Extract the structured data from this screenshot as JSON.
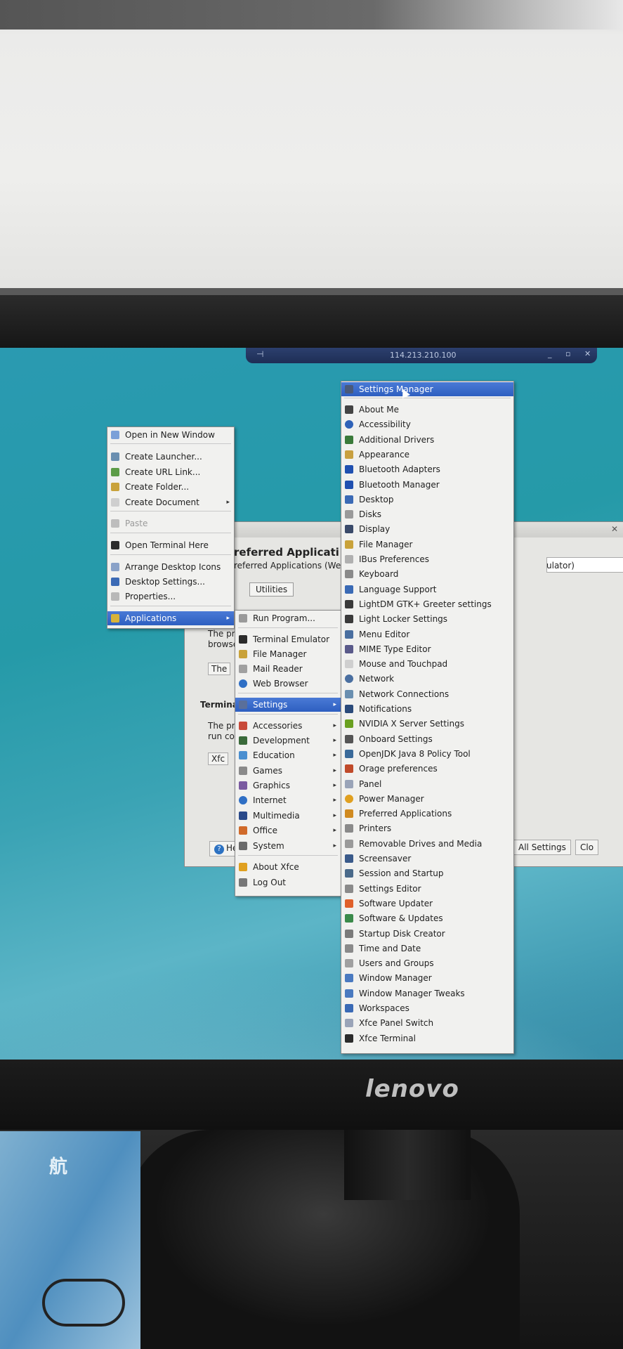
{
  "remote_bar": {
    "ip": "114.213.210.100",
    "pin_glyph": "⊣",
    "controls": "_ ▫ ✕"
  },
  "context_menu": {
    "items": [
      {
        "label": "Open in New Window",
        "highlighted": false,
        "disabled": false,
        "icon": "window-icon"
      },
      {
        "label": "Create Launcher...",
        "disabled": false,
        "icon": "launcher-icon"
      },
      {
        "label": "Create URL Link...",
        "disabled": false,
        "icon": "link-icon"
      },
      {
        "label": "Create Folder...",
        "disabled": false,
        "icon": "folder-icon"
      },
      {
        "label": "Create Document",
        "disabled": false,
        "submenu": true,
        "icon": "document-icon"
      },
      {
        "label": "Paste",
        "disabled": true,
        "icon": "paste-icon"
      },
      {
        "label": "Open Terminal Here",
        "disabled": false,
        "icon": "terminal-icon"
      },
      {
        "label": "Arrange Desktop Icons",
        "disabled": false,
        "icon": "arrange-icon"
      },
      {
        "label": "Desktop Settings...",
        "disabled": false,
        "icon": "desktop-icon"
      },
      {
        "label": "Properties...",
        "disabled": false,
        "icon": "properties-icon"
      },
      {
        "label": "Applications",
        "highlighted": true,
        "submenu": true,
        "icon": "applications-icon"
      }
    ]
  },
  "applications_menu": {
    "items": [
      {
        "label": "Run Program...",
        "icon": "run-icon"
      },
      {
        "label": "Terminal Emulator",
        "icon": "terminal-icon"
      },
      {
        "label": "File Manager",
        "icon": "file-manager-icon"
      },
      {
        "label": "Mail Reader",
        "icon": "mail-icon"
      },
      {
        "label": "Web Browser",
        "icon": "globe-icon"
      },
      {
        "label": "Settings",
        "highlighted": true,
        "submenu": true,
        "icon": "settings-icon"
      },
      {
        "label": "Accessories",
        "submenu": true,
        "icon": "accessories-icon"
      },
      {
        "label": "Development",
        "submenu": true,
        "icon": "development-icon"
      },
      {
        "label": "Education",
        "submenu": true,
        "icon": "education-icon"
      },
      {
        "label": "Games",
        "submenu": true,
        "icon": "games-icon"
      },
      {
        "label": "Graphics",
        "submenu": true,
        "icon": "graphics-icon"
      },
      {
        "label": "Internet",
        "submenu": true,
        "icon": "internet-icon"
      },
      {
        "label": "Multimedia",
        "submenu": true,
        "icon": "multimedia-icon"
      },
      {
        "label": "Office",
        "submenu": true,
        "icon": "office-icon"
      },
      {
        "label": "System",
        "submenu": true,
        "icon": "system-icon"
      },
      {
        "label": "About Xfce",
        "icon": "star-icon"
      },
      {
        "label": "Log Out",
        "icon": "logout-icon"
      }
    ]
  },
  "settings_menu": {
    "items": [
      {
        "label": "Settings Manager",
        "highlighted": true,
        "icon": "settings-manager-icon"
      },
      {
        "label": "About Me",
        "icon": "user-icon"
      },
      {
        "label": "Accessibility",
        "icon": "accessibility-icon"
      },
      {
        "label": "Additional Drivers",
        "icon": "chip-icon"
      },
      {
        "label": "Appearance",
        "icon": "appearance-icon"
      },
      {
        "label": "Bluetooth Adapters",
        "icon": "bluetooth-icon"
      },
      {
        "label": "Bluetooth Manager",
        "icon": "bluetooth-icon"
      },
      {
        "label": "Desktop",
        "icon": "desktop-icon"
      },
      {
        "label": "Disks",
        "icon": "disk-icon"
      },
      {
        "label": "Display",
        "icon": "display-icon"
      },
      {
        "label": "File Manager",
        "icon": "file-manager-icon"
      },
      {
        "label": "IBus Preferences",
        "icon": "ibus-icon"
      },
      {
        "label": "Keyboard",
        "icon": "keyboard-icon"
      },
      {
        "label": "Language Support",
        "icon": "language-icon"
      },
      {
        "label": "LightDM GTK+ Greeter settings",
        "icon": "lightdm-icon"
      },
      {
        "label": "Light Locker Settings",
        "icon": "lock-icon"
      },
      {
        "label": "Menu Editor",
        "icon": "menu-editor-icon"
      },
      {
        "label": "MIME Type Editor",
        "icon": "mime-icon"
      },
      {
        "label": "Mouse and Touchpad",
        "icon": "mouse-icon"
      },
      {
        "label": "Network",
        "icon": "network-icon"
      },
      {
        "label": "Network Connections",
        "icon": "network-connections-icon"
      },
      {
        "label": "Notifications",
        "icon": "notifications-icon"
      },
      {
        "label": "NVIDIA X Server Settings",
        "icon": "nvidia-icon"
      },
      {
        "label": "Onboard Settings",
        "icon": "onboard-icon"
      },
      {
        "label": "OpenJDK Java 8 Policy Tool",
        "icon": "java-icon"
      },
      {
        "label": "Orage preferences",
        "icon": "calendar-icon"
      },
      {
        "label": "Panel",
        "icon": "panel-icon"
      },
      {
        "label": "Power Manager",
        "icon": "power-icon"
      },
      {
        "label": "Preferred Applications",
        "icon": "preferred-apps-icon"
      },
      {
        "label": "Printers",
        "icon": "printer-icon"
      },
      {
        "label": "Removable Drives and Media",
        "icon": "removable-drive-icon"
      },
      {
        "label": "Screensaver",
        "icon": "screensaver-icon"
      },
      {
        "label": "Session and Startup",
        "icon": "session-icon"
      },
      {
        "label": "Settings Editor",
        "icon": "settings-editor-icon"
      },
      {
        "label": "Software Updater",
        "icon": "updater-icon"
      },
      {
        "label": "Software & Updates",
        "icon": "software-icon"
      },
      {
        "label": "Startup Disk Creator",
        "icon": "startup-disk-icon"
      },
      {
        "label": "Time and Date",
        "icon": "clock-icon"
      },
      {
        "label": "Users and Groups",
        "icon": "users-icon"
      },
      {
        "label": "Window Manager",
        "icon": "window-manager-icon"
      },
      {
        "label": "Window Manager Tweaks",
        "icon": "window-tweaks-icon"
      },
      {
        "label": "Workspaces",
        "icon": "workspaces-icon"
      },
      {
        "label": "Xfce Panel Switch",
        "icon": "panel-switch-icon"
      },
      {
        "label": "Xfce Terminal",
        "icon": "terminal-icon"
      }
    ]
  },
  "background_window": {
    "heading": "referred Applicati",
    "subheading": "referred Applications (We",
    "tab": "Utilities",
    "field_label": "ulator)",
    "sec_a_line1": "The pr",
    "sec_a_line2": "browse",
    "sec_a_button": "The",
    "term_label": "Termina",
    "sec_c_line1": "The pr",
    "sec_c_line2": "run co",
    "sec_c_button": "Xfc",
    "help_button": "He",
    "all_settings_button": "All Settings",
    "close_button": "Clo"
  },
  "monitor": {
    "brand": "lenovo"
  },
  "desk": {
    "book_text": "航"
  },
  "colors": {
    "highlight": "#2e5fc0",
    "menu_bg": "#f1f1ef",
    "desktop": "#2a9ab1"
  }
}
